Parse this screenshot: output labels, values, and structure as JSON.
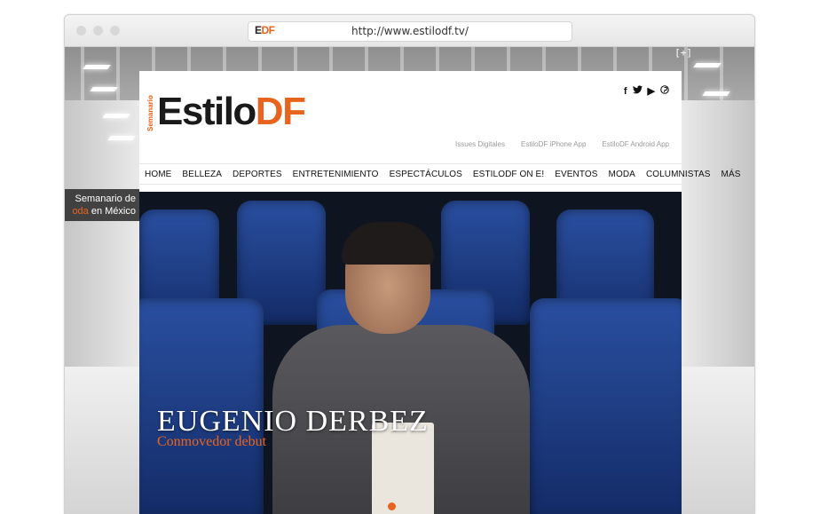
{
  "browser": {
    "url": "http://www.estilodf.tv/",
    "favicon": {
      "e": "E",
      "df": "DF"
    }
  },
  "background": {
    "expand_label": "[+]",
    "tagline_line1": "Semanario de",
    "tagline_line2_orange": "oda",
    "tagline_line2_rest": " en México"
  },
  "site": {
    "logo": {
      "vertical": "Semanario",
      "estilo": "Estilo",
      "df": "DF"
    },
    "social": [
      {
        "icon": "facebook-icon",
        "glyph": "f"
      },
      {
        "icon": "twitter-icon",
        "glyph": "𝕥"
      },
      {
        "icon": "youtube-icon",
        "glyph": "▶"
      },
      {
        "icon": "pinterest-icon",
        "glyph": "℗"
      }
    ],
    "app_links": [
      "Issues Digitales",
      "EstiloDF iPhone App",
      "EstiloDF Android App"
    ],
    "nav": [
      "HOME",
      "BELLEZA",
      "DEPORTES",
      "ENTRETENIMIENTO",
      "ESPECTÁCULOS",
      "ESTILODF ON E!",
      "EVENTOS",
      "MODA",
      "COLUMNISTAS",
      "MÁS"
    ],
    "hero": {
      "title": "EUGENIO DERBEZ",
      "subtitle": "Conmovedor debut"
    },
    "colors": {
      "accent": "#e8641e",
      "seat": "#1f3f8a"
    }
  }
}
